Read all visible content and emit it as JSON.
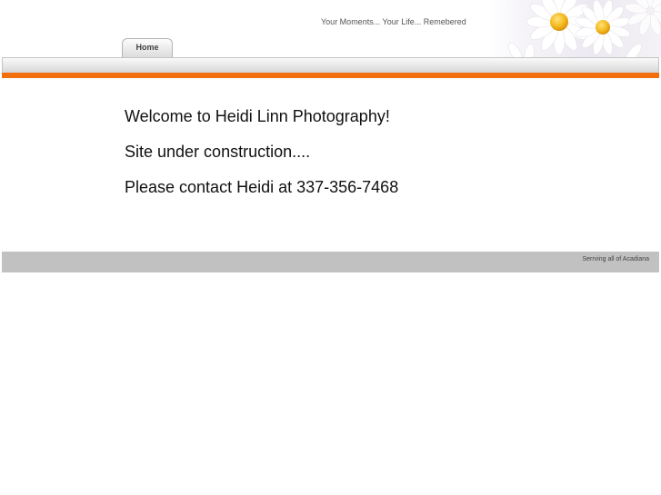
{
  "header": {
    "tagline": "Your Moments... Your Life... Remebered"
  },
  "nav": {
    "tabs": [
      {
        "label": "Home"
      }
    ]
  },
  "main": {
    "lines": [
      "Welcome to Heidi Linn Photography!",
      "Site under construction....",
      "Please contact Heidi at 337-356-7468"
    ]
  },
  "footer": {
    "text": "Serrving all of Acadiana"
  },
  "colors": {
    "accent": "#f26f10",
    "footer_bg": "#c1c1c1",
    "flower_petal": "#ffffff",
    "flower_center": "#f4b81c"
  },
  "icons": {
    "header_art": "daisy-flowers"
  }
}
